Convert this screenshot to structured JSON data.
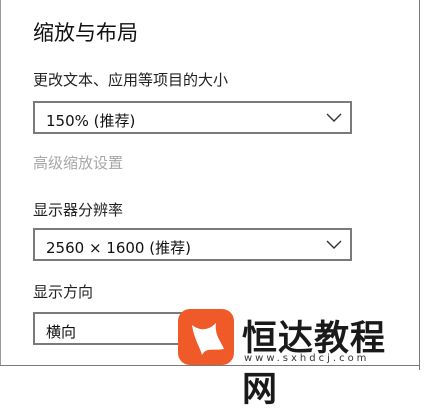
{
  "section_title": "缩放与布局",
  "scale": {
    "label": "更改文本、应用等项目的大小",
    "selected": "150% (推荐)"
  },
  "advanced_link": "高级缩放设置",
  "resolution": {
    "label": "显示器分辨率",
    "selected": "2560 × 1600 (推荐)"
  },
  "orientation": {
    "label": "显示方向",
    "selected": "横向"
  },
  "watermark": {
    "name": "恒达教程网",
    "url": "www.sxhdcj.com"
  },
  "colors": {
    "watermark_logo": "#f05a28",
    "disabled_text": "#a7a7a7",
    "dropdown_border": "#7a7a7a"
  }
}
